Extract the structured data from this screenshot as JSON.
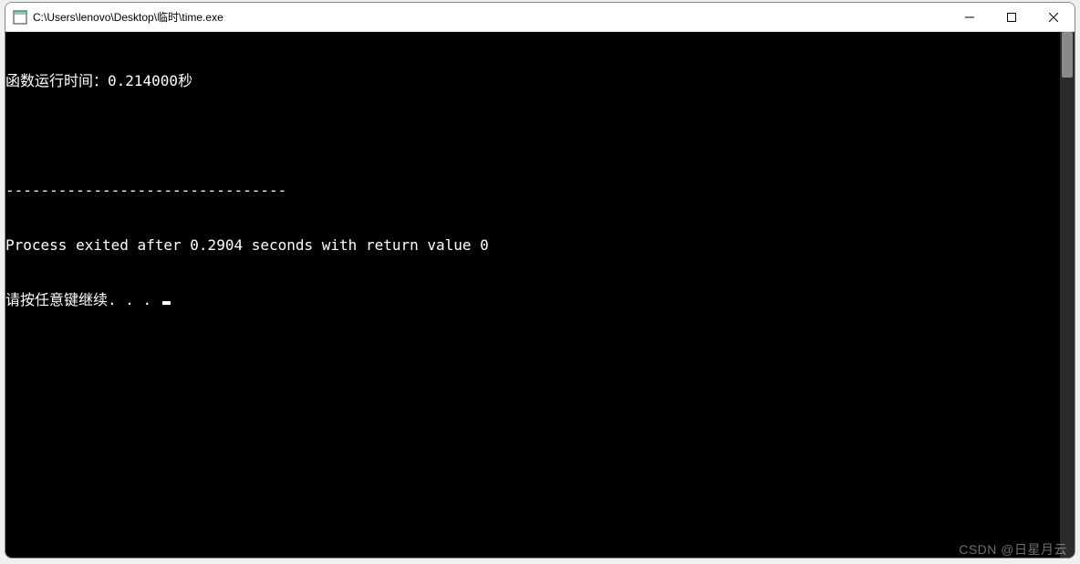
{
  "window": {
    "title": "C:\\Users\\lenovo\\Desktop\\临时\\time.exe"
  },
  "console": {
    "lines": {
      "runtime": "函数运行时间：0.214000秒",
      "empty": "",
      "separator": "--------------------------------",
      "exited": "Process exited after 0.2904 seconds with return value 0",
      "prompt": "请按任意键继续. . . "
    }
  },
  "watermark": "CSDN @日星月云"
}
